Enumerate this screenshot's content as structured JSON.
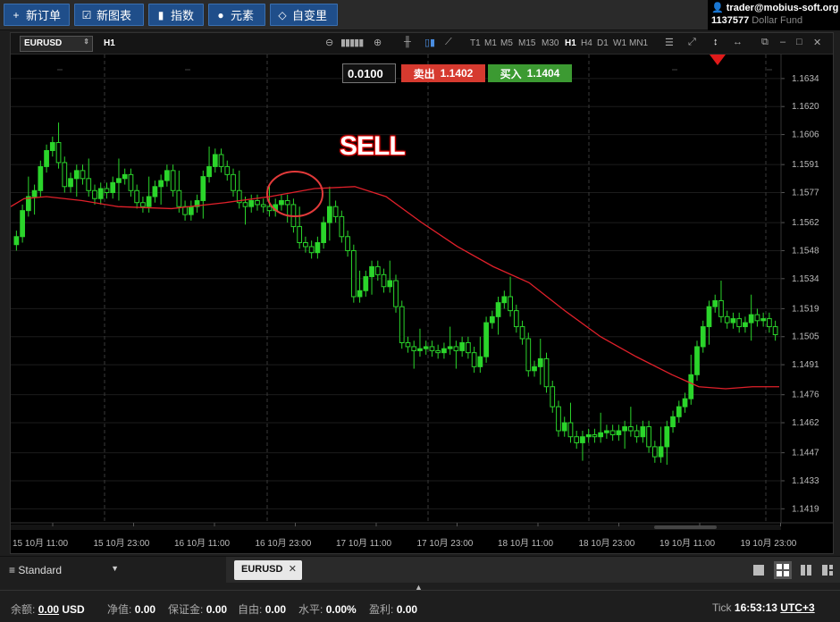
{
  "toolbar": {
    "buttons": [
      {
        "icon": "plus-icon",
        "glyph": "+",
        "label": "新订单"
      },
      {
        "icon": "chart-check-icon",
        "glyph": "☑",
        "label": "新图表"
      },
      {
        "icon": "bar-chart-icon",
        "glyph": "▮",
        "label": "指数"
      },
      {
        "icon": "shapes-icon",
        "glyph": "●",
        "label": "元素"
      },
      {
        "icon": "diamond-icon",
        "glyph": "◇",
        "label": "自变里"
      }
    ]
  },
  "account": {
    "email": "trader@mobius-soft.org",
    "number": "1137577",
    "fund": "Dollar Fund"
  },
  "chart": {
    "symbol": "EURUSD",
    "timeframe": "H1",
    "timeframes": [
      "T1",
      "M1",
      "M5",
      "M15",
      "M30",
      "H1",
      "H4",
      "D1",
      "W1",
      "MN1"
    ],
    "active_timeframe": "H1",
    "lot_value": "0.0100",
    "sell_label": "卖出",
    "sell_price": "1.1402",
    "buy_label": "买入",
    "buy_price": "1.1404",
    "annotation": "SELL",
    "colors": {
      "bull": "#2bd52b",
      "ma": "#e0202a",
      "sell": "#d63a2f",
      "buy": "#3c9a32"
    }
  },
  "chart_data": {
    "type": "candlestick",
    "price_ticks": [
      "1.1634",
      "1.1620",
      "1.1606",
      "1.1591",
      "1.1577",
      "1.1562",
      "1.1548",
      "1.1534",
      "1.1519",
      "1.1505",
      "1.1491",
      "1.1476",
      "1.1462",
      "1.1447",
      "1.1433",
      "1.1419"
    ],
    "time_ticks": [
      "15 10月 11:00",
      "15 10月 23:00",
      "16 10月 11:00",
      "16 10月 23:00",
      "17 10月 11:00",
      "17 10月 23:00",
      "18 10月 11:00",
      "18 10月 23:00",
      "19 10月 11:00",
      "19 10月 23:00"
    ],
    "ylim": [
      1.1412,
      1.1646
    ],
    "close": [
      1.1555,
      1.1568,
      1.1575,
      1.1578,
      1.159,
      1.1598,
      1.1602,
      1.1592,
      1.158,
      1.1584,
      1.1588,
      1.1584,
      1.1578,
      1.1574,
      1.1579,
      1.1577,
      1.1582,
      1.1584,
      1.1586,
      1.1578,
      1.1572,
      1.157,
      1.1575,
      1.158,
      1.1583,
      1.1588,
      1.1578,
      1.157,
      1.1566,
      1.157,
      1.1573,
      1.1585,
      1.159,
      1.1596,
      1.159,
      1.1586,
      1.1578,
      1.1572,
      1.157,
      1.1573,
      1.1571,
      1.157,
      1.1568,
      1.1571,
      1.1573,
      1.1571,
      1.156,
      1.1552,
      1.155,
      1.1547,
      1.1552,
      1.1562,
      1.157,
      1.1565,
      1.1555,
      1.1548,
      1.1525,
      1.1528,
      1.1535,
      1.154,
      1.1536,
      1.153,
      1.1533,
      1.152,
      1.1502,
      1.15,
      1.1498,
      1.1499,
      1.15,
      1.1498,
      1.1497,
      1.1499,
      1.15,
      1.1498,
      1.1502,
      1.1497,
      1.149,
      1.1495,
      1.1512,
      1.1515,
      1.1522,
      1.1525,
      1.1518,
      1.151,
      1.1504,
      1.1488,
      1.149,
      1.1494,
      1.148,
      1.147,
      1.1458,
      1.1462,
      1.1455,
      1.1452,
      1.1455,
      1.1456,
      1.1455,
      1.1457,
      1.1458,
      1.1456,
      1.1458,
      1.146,
      1.1458,
      1.1455,
      1.146,
      1.145,
      1.1445,
      1.145,
      1.146,
      1.1465,
      1.147,
      1.1474,
      1.1486,
      1.15,
      1.151,
      1.152,
      1.1523,
      1.1515,
      1.1512,
      1.1514,
      1.151,
      1.1512,
      1.1516,
      1.1513,
      1.1514,
      1.151,
      1.1506
    ],
    "ma": [
      [
        0,
        1.157
      ],
      [
        15,
        1.1574
      ],
      [
        40,
        1.1575
      ],
      [
        80,
        1.1573
      ],
      [
        120,
        1.157
      ],
      [
        180,
        1.1569
      ],
      [
        240,
        1.1572
      ],
      [
        290,
        1.1575
      ],
      [
        340,
        1.1579
      ],
      [
        385,
        1.158
      ],
      [
        420,
        1.1575
      ],
      [
        460,
        1.1562
      ],
      [
        500,
        1.155
      ],
      [
        540,
        1.154
      ],
      [
        580,
        1.1532
      ],
      [
        620,
        1.1518
      ],
      [
        660,
        1.1505
      ],
      [
        700,
        1.1495
      ],
      [
        740,
        1.1486
      ],
      [
        770,
        1.148
      ],
      [
        800,
        1.1479
      ],
      [
        830,
        1.148
      ],
      [
        860,
        1.148
      ]
    ]
  },
  "bottom": {
    "layout": "Standard",
    "tab": "EURUSD"
  },
  "status": {
    "balance_label": "余额:",
    "balance": "0.00",
    "currency": "USD",
    "equity_label": "净值:",
    "equity": "0.00",
    "margin_label": "保证金:",
    "margin": "0.00",
    "free_label": "自由:",
    "free": "0.00",
    "level_label": "水平:",
    "level": "0.00%",
    "profit_label": "盈利:",
    "profit": "0.00",
    "tick_label": "Tick",
    "time": "16:53:13",
    "timezone": "UTC+3"
  }
}
